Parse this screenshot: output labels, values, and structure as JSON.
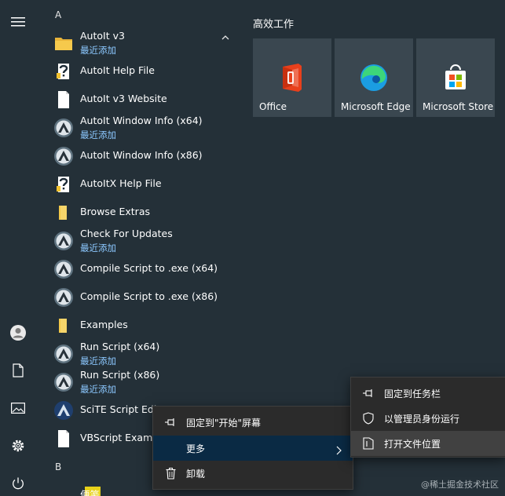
{
  "rail": {
    "icons": [
      "hamburger-menu-icon",
      "user-icon",
      "document-icon",
      "pictures-icon",
      "settings-icon",
      "power-icon"
    ]
  },
  "list": {
    "section_a": "A",
    "section_b": "B",
    "recent_label": "最近添加",
    "folder": {
      "label": "AutoIt v3",
      "sub": "最近添加"
    },
    "items": [
      {
        "label": "AutoIt Help File",
        "icon": "help-file-icon"
      },
      {
        "label": "AutoIt v3 Website",
        "icon": "web-file-icon"
      },
      {
        "label": "AutoIt Window Info (x64)",
        "sub": "最近添加",
        "icon": "autoit-icon"
      },
      {
        "label": "AutoIt Window Info (x86)",
        "icon": "autoit-icon"
      },
      {
        "label": "AutoItX Help File",
        "icon": "help-file-icon"
      },
      {
        "label": "Browse Extras",
        "icon": "folder-icon"
      },
      {
        "label": "Check For Updates",
        "sub": "最近添加",
        "icon": "autoit-icon"
      },
      {
        "label": "Compile Script to .exe (x64)",
        "icon": "autoit-icon"
      },
      {
        "label": "Compile Script to .exe (x86)",
        "icon": "autoit-icon"
      },
      {
        "label": "Examples",
        "icon": "folder-icon"
      },
      {
        "label": "Run Script (x64)",
        "sub": "最近添加",
        "icon": "autoit-icon"
      },
      {
        "label": "Run Script (x86)",
        "sub": "最近添加",
        "icon": "autoit-icon"
      },
      {
        "label": "SciTE Script Editor",
        "icon": "scite-icon"
      },
      {
        "label": "VBScript Examples",
        "icon": "web-file-icon"
      }
    ],
    "next_item": {
      "label": "便笺",
      "icon": "sticky-notes-icon"
    }
  },
  "tiles": {
    "group_title": "高效工作",
    "items": [
      {
        "label": "Office",
        "icon": "office-icon"
      },
      {
        "label": "Microsoft Edge",
        "icon": "edge-icon"
      },
      {
        "label": "Microsoft Store",
        "icon": "store-icon"
      }
    ]
  },
  "context_menu": {
    "items": [
      {
        "label": "固定到\"开始\"屏幕",
        "icon": "pin-icon"
      },
      {
        "label": "更多",
        "icon": ""
      },
      {
        "label": "卸载",
        "icon": "trash-icon"
      }
    ]
  },
  "submenu": {
    "items": [
      {
        "label": "固定到任务栏",
        "icon": "pin-icon"
      },
      {
        "label": "以管理员身份运行",
        "icon": "shield-icon"
      },
      {
        "label": "打开文件位置",
        "icon": "file-location-icon"
      }
    ]
  },
  "watermark": "@稀土掘金技术社区",
  "colors": {
    "background": "#243038",
    "accent": "#8cc8ff",
    "tile": "#3a4750",
    "menu": "#2b2b2b",
    "menu_highlight": "#0a2a44"
  }
}
